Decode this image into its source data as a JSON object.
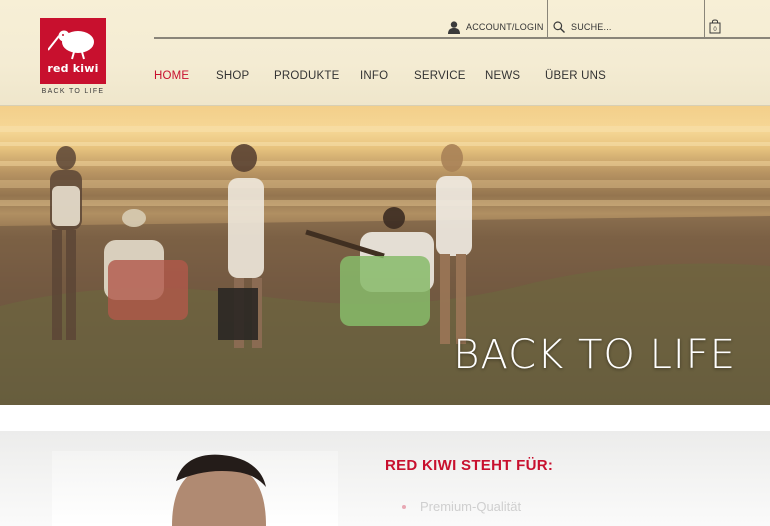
{
  "brand": {
    "logo_text": "red kiwi",
    "tagline": "BACK TO LIFE",
    "color": "#c8102e"
  },
  "topbar": {
    "account_label": "ACCOUNT/LOGIN",
    "account_icon": "user-icon",
    "search_label": "SUCHE...",
    "search_icon": "search-icon",
    "cart_icon": "shopping-bag-icon",
    "cart_count": "0"
  },
  "nav": {
    "items": [
      {
        "label": "HOME",
        "active": true
      },
      {
        "label": "SHOP",
        "active": false
      },
      {
        "label": "PRODUKTE",
        "active": false
      },
      {
        "label": "INFO",
        "active": false
      },
      {
        "label": "SERVICE",
        "active": false
      },
      {
        "label": "NEWS",
        "active": false
      },
      {
        "label": "ÜBER UNS",
        "active": false
      }
    ]
  },
  "hero": {
    "headline": "BACK TO LIFE"
  },
  "content": {
    "title": "RED KIWI STEHT FÜR:",
    "bullets": [
      "Premium-Qualität"
    ]
  }
}
